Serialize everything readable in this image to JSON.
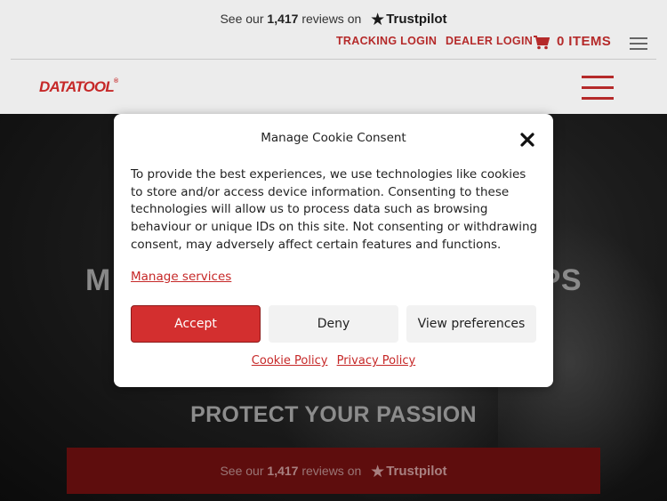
{
  "trustpilot": {
    "prefix": "See our",
    "count": "1,417",
    "suffix": "reviews on",
    "brand": "Trustpilot"
  },
  "header": {
    "tracking_login": "TRACKING LOGIN",
    "dealer_login": "DEALER LOGIN",
    "cart_label": "0 ITEMS",
    "logo_text": "DATATOOL",
    "logo_mark": "®"
  },
  "hero": {
    "heading_left": "M",
    "heading_right": "PS",
    "subheading": "PROTECT YOUR PASSION"
  },
  "cookie_modal": {
    "title": "Manage Cookie Consent",
    "body": "To provide the best experiences, we use technologies like cookies to store and/or access device information. Consenting to these technologies will allow us to process data such as browsing behaviour or unique IDs on this site. Not consenting or withdrawing consent, may adversely affect certain features and functions.",
    "manage_services": "Manage services",
    "accept": "Accept",
    "deny": "Deny",
    "view_preferences": "View preferences",
    "cookie_policy": "Cookie Policy",
    "privacy_policy": "Privacy Policy"
  },
  "colors": {
    "brand_red": "#c62828",
    "accept_bg": "#d32f2f",
    "trustpilot_bar_bg": "#5e0d0d"
  },
  "icons": [
    "trustpilot-star-icon",
    "cart-icon",
    "hamburger-menu-icon",
    "close-icon"
  ]
}
